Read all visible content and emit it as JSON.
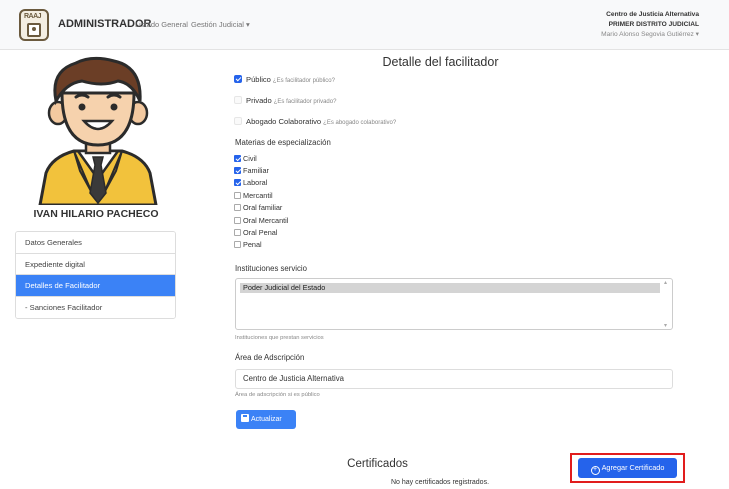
{
  "navbar": {
    "brand": "ADMINISTRADOR",
    "logo_text": "RAAJ",
    "links": [
      "Listado General",
      "Gestión Judicial ▾"
    ],
    "org_line1": "Centro de Justicia Alternativa",
    "org_line2": "PRIMER DISTRITO JUDICIAL",
    "user_name": "Mario Alonso Segovia Gutiérrez ▾"
  },
  "profile": {
    "name": "IVAN HILARIO PACHECO",
    "menu": [
      {
        "label": "Datos Generales",
        "active": false
      },
      {
        "label": "Expediente digital",
        "active": false
      },
      {
        "label": "Detalles de Facilitador",
        "active": true
      },
      {
        "label": "- Sanciones Facilitador",
        "active": false
      }
    ]
  },
  "form": {
    "title": "Detalle del facilitador",
    "publico_label": "Público",
    "publico_hint": "¿Es facilitador público?",
    "privado_label": "Privado",
    "privado_hint": "¿Es facilitador privado?",
    "abogado_label": "Abogado Colaborativo",
    "abogado_hint": "¿Es abogado colaborativo?",
    "materias_label": "Materias de especialización",
    "materias": [
      {
        "label": "Civil",
        "checked": true
      },
      {
        "label": "Familiar",
        "checked": true
      },
      {
        "label": "Laboral",
        "checked": true
      },
      {
        "label": "Mercantil",
        "checked": false
      },
      {
        "label": "Oral familiar",
        "checked": false
      },
      {
        "label": "Oral Mercantil",
        "checked": false
      },
      {
        "label": "Oral Penal",
        "checked": false
      },
      {
        "label": "Penal",
        "checked": false
      }
    ],
    "instituciones_label": "Instituciones servicio",
    "instituciones_selected": "Poder Judicial del Estado",
    "instituciones_help": "Instituciones que prestan servicios",
    "area_label": "Área de Adscripción",
    "area_value": "Centro de Justicia Alternativa",
    "area_help": "Área de adscripción si es público",
    "update_button": "Actualizar"
  },
  "certificates": {
    "title": "Certificados",
    "empty_message": "No hay certificados registrados.",
    "add_button": "Agregar Certificado"
  },
  "colors": {
    "accent": "#3b82f6",
    "highlight_border": "#e11d1d"
  }
}
